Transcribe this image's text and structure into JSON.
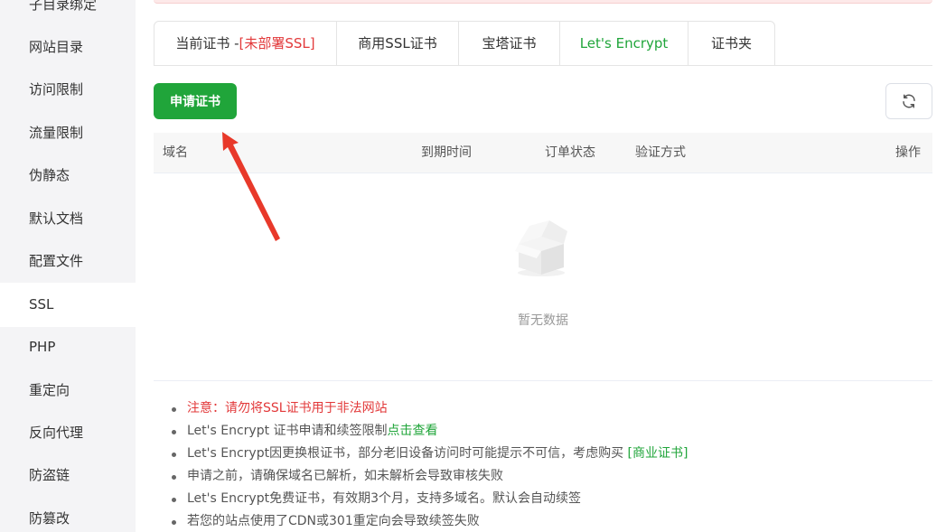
{
  "sidebar": {
    "items": [
      {
        "label": "子目录绑定"
      },
      {
        "label": "网站目录"
      },
      {
        "label": "访问限制"
      },
      {
        "label": "流量限制"
      },
      {
        "label": "伪静态"
      },
      {
        "label": "默认文档"
      },
      {
        "label": "配置文件"
      },
      {
        "label": "SSL",
        "active": true
      },
      {
        "label": "PHP"
      },
      {
        "label": "重定向"
      },
      {
        "label": "反向代理"
      },
      {
        "label": "防盗链"
      },
      {
        "label": "防篡改"
      }
    ]
  },
  "tabs": {
    "current_label": "当前证书 -",
    "current_status": "[未部署SSL]",
    "commercial": "商用SSL证书",
    "baota": "宝塔证书",
    "letsencrypt": "Let's Encrypt",
    "folder": "证书夹"
  },
  "toolbar": {
    "apply_label": "申请证书",
    "refresh_icon": "refresh-icon"
  },
  "table": {
    "columns": [
      "域名",
      "到期时间",
      "订单状态",
      "验证方式",
      "操作"
    ],
    "empty_text": "暂无数据"
  },
  "notes": {
    "n1": "注意：请勿将SSL证书用于非法网站",
    "n2_text": "Let's Encrypt 证书申请和续签限制",
    "n2_link": "点击查看",
    "n3_text": "Let's Encrypt因更换根证书，部分老旧设备访问时可能提示不可信，考虑购买 ",
    "n3_link": "[商业证书]",
    "n4": "申请之前，请确保域名已解析，如未解析会导致审核失败",
    "n5": "Let's Encrypt免费证书，有效期3个月，支持多域名。默认会自动续签",
    "n6": "若您的站点使用了CDN或301重定向会导致续签失败"
  },
  "colors": {
    "accent": "#20a53a",
    "warning": "#e2393a",
    "arrow": "#e8392a"
  }
}
